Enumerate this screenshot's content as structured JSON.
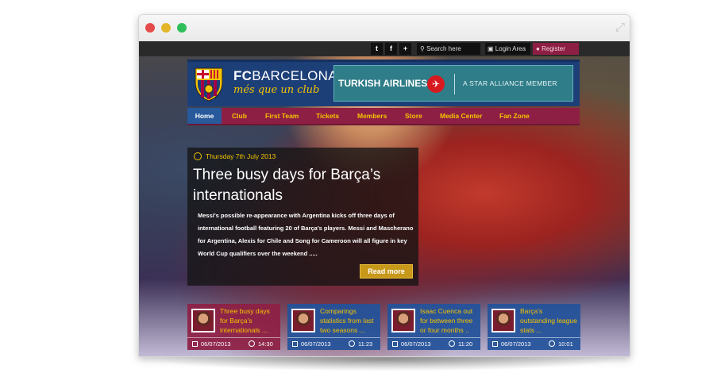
{
  "topbar": {
    "twitter_glyph": "t",
    "facebook_glyph": "f",
    "add_glyph": "+",
    "search_placeholder": "Search here",
    "login_label": "Login Area",
    "register_label": "Register"
  },
  "header": {
    "brand_prefix": "FC",
    "brand_suffix": "BARCELONA",
    "motto": "més que un club",
    "sponsor_name": "TURKISH AIRLINES",
    "sponsor_alliance": "A STAR ALLIANCE MEMBER"
  },
  "nav": {
    "items": [
      {
        "label": "Home"
      },
      {
        "label": "Club"
      },
      {
        "label": "First Team"
      },
      {
        "label": "Tickets"
      },
      {
        "label": "Members"
      },
      {
        "label": "Store"
      },
      {
        "label": "Media Center"
      },
      {
        "label": "Fan Zone"
      }
    ]
  },
  "hero": {
    "date": "Thursday 7th July 2013",
    "title": "Three busy days for Barça’s internationals",
    "text": "Messi's possible re-appearance with Argentina kicks off three days of international football featuring 20 of Barça's players. Messi and Mascherano for Argentina, Alexis for Chile and Song for Cameroon will all figure in key World Cup qualifiers over the weekend .....",
    "read_more": "Read more"
  },
  "cards": [
    {
      "title": "Three busy days for Barça’s internationals ...",
      "date": "06/07/2013",
      "time": "14:30"
    },
    {
      "title": "Comparings statistics from last two seasons ...",
      "date": "06/07/2013",
      "time": "11:23"
    },
    {
      "title": "Isaac Cuenca out for between three or four months ..",
      "date": "06/07/2013",
      "time": "11:20"
    },
    {
      "title": "Barça’s outstanding league stats ...",
      "date": "06/07/2013",
      "time": "10:01"
    }
  ],
  "colors": {
    "brand_blue": "#1d3f78",
    "brand_maroon": "#8e1f44",
    "brand_gold": "#f5c400",
    "sponsor_teal": "#2f7d88"
  }
}
